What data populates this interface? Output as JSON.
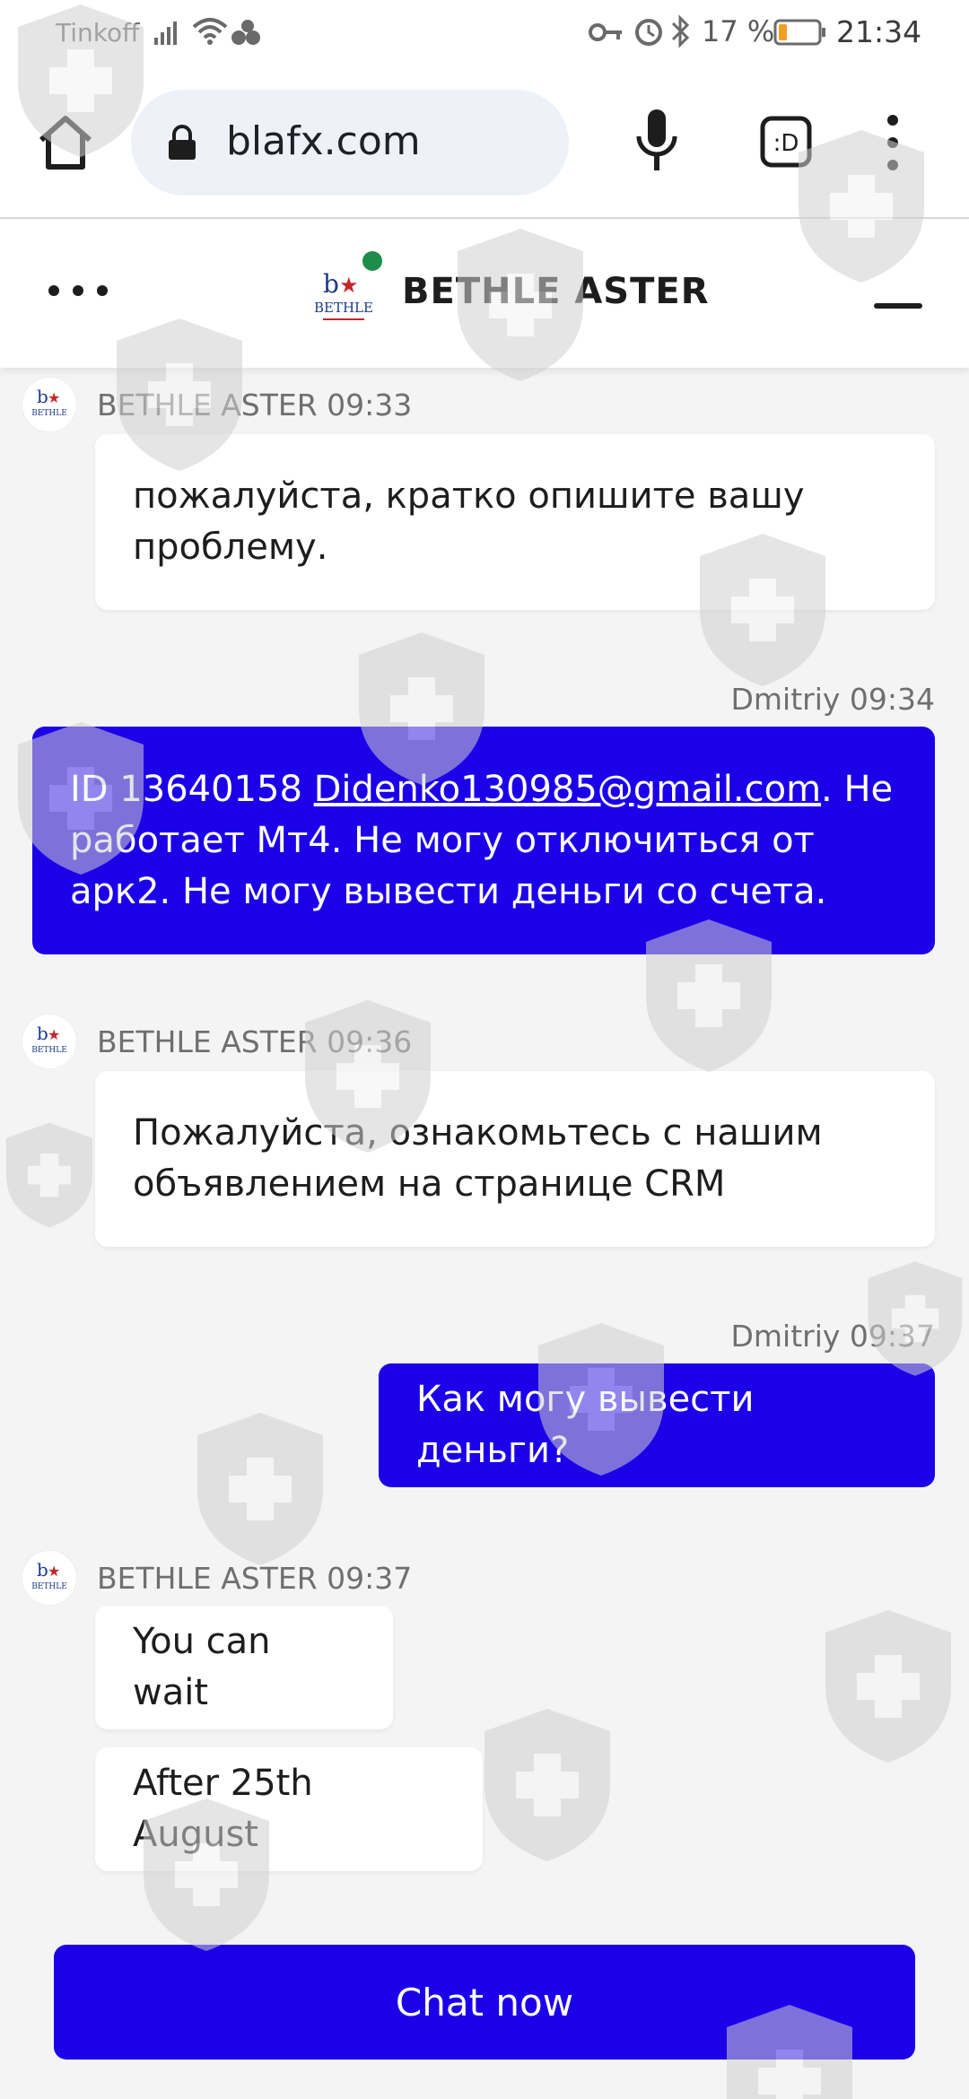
{
  "status_bar": {
    "carrier": "Tinkoff",
    "battery_percent": "17 %",
    "time": "21:34",
    "icons": [
      "signal-icon",
      "wifi-icon",
      "notification-dots-icon",
      "key-icon",
      "alarm-icon",
      "bluetooth-icon",
      "battery-icon"
    ]
  },
  "browser": {
    "url": "blafx.com",
    "icons": [
      "home-icon",
      "lock-icon",
      "mic-icon",
      "tab-switcher-icon",
      "overflow-menu-icon"
    ]
  },
  "chat_header": {
    "title": "BETHLE ASTER",
    "online_color": "#1e8c4b",
    "logo_text": "BETHLE"
  },
  "messages": [
    {
      "sender": "BETHLE ASTER",
      "time": "09:33",
      "meta": "BETHLE ASTER 09:33",
      "direction": "in",
      "text": "пожалуйста, кратко опишите вашу проблему."
    },
    {
      "sender": "Dmitriy",
      "time": "09:34",
      "meta": "Dmitriy 09:34",
      "direction": "out",
      "text_prefix": "ID 13640158 ",
      "email": "Didenko130985@gmail.com",
      "text_suffix": ". Не работает Мт4. Не могу отключиться от арк2. Не могу вывести деньги со счета."
    },
    {
      "sender": "BETHLE ASTER",
      "time": "09:36",
      "meta": "BETHLE ASTER 09:36",
      "direction": "in",
      "text": "Пожалуйста, ознакомьтесь с нашим объявлением на странице CRM"
    },
    {
      "sender": "Dmitriy",
      "time": "09:37",
      "meta": "Dmitriy 09:37",
      "direction": "out",
      "text": "Как могу вывести деньги?"
    },
    {
      "sender": "BETHLE ASTER",
      "time": "09:37",
      "meta": "BETHLE ASTER 09:37",
      "direction": "in",
      "text": "You can wait"
    },
    {
      "sender": "BETHLE ASTER",
      "time": "09:37",
      "direction": "in",
      "text": "After 25th August"
    }
  ],
  "chat_now_label": "Chat now",
  "colors": {
    "accent": "#1b00e8",
    "background": "#f4f4f4",
    "bubble_in": "#ffffff"
  }
}
